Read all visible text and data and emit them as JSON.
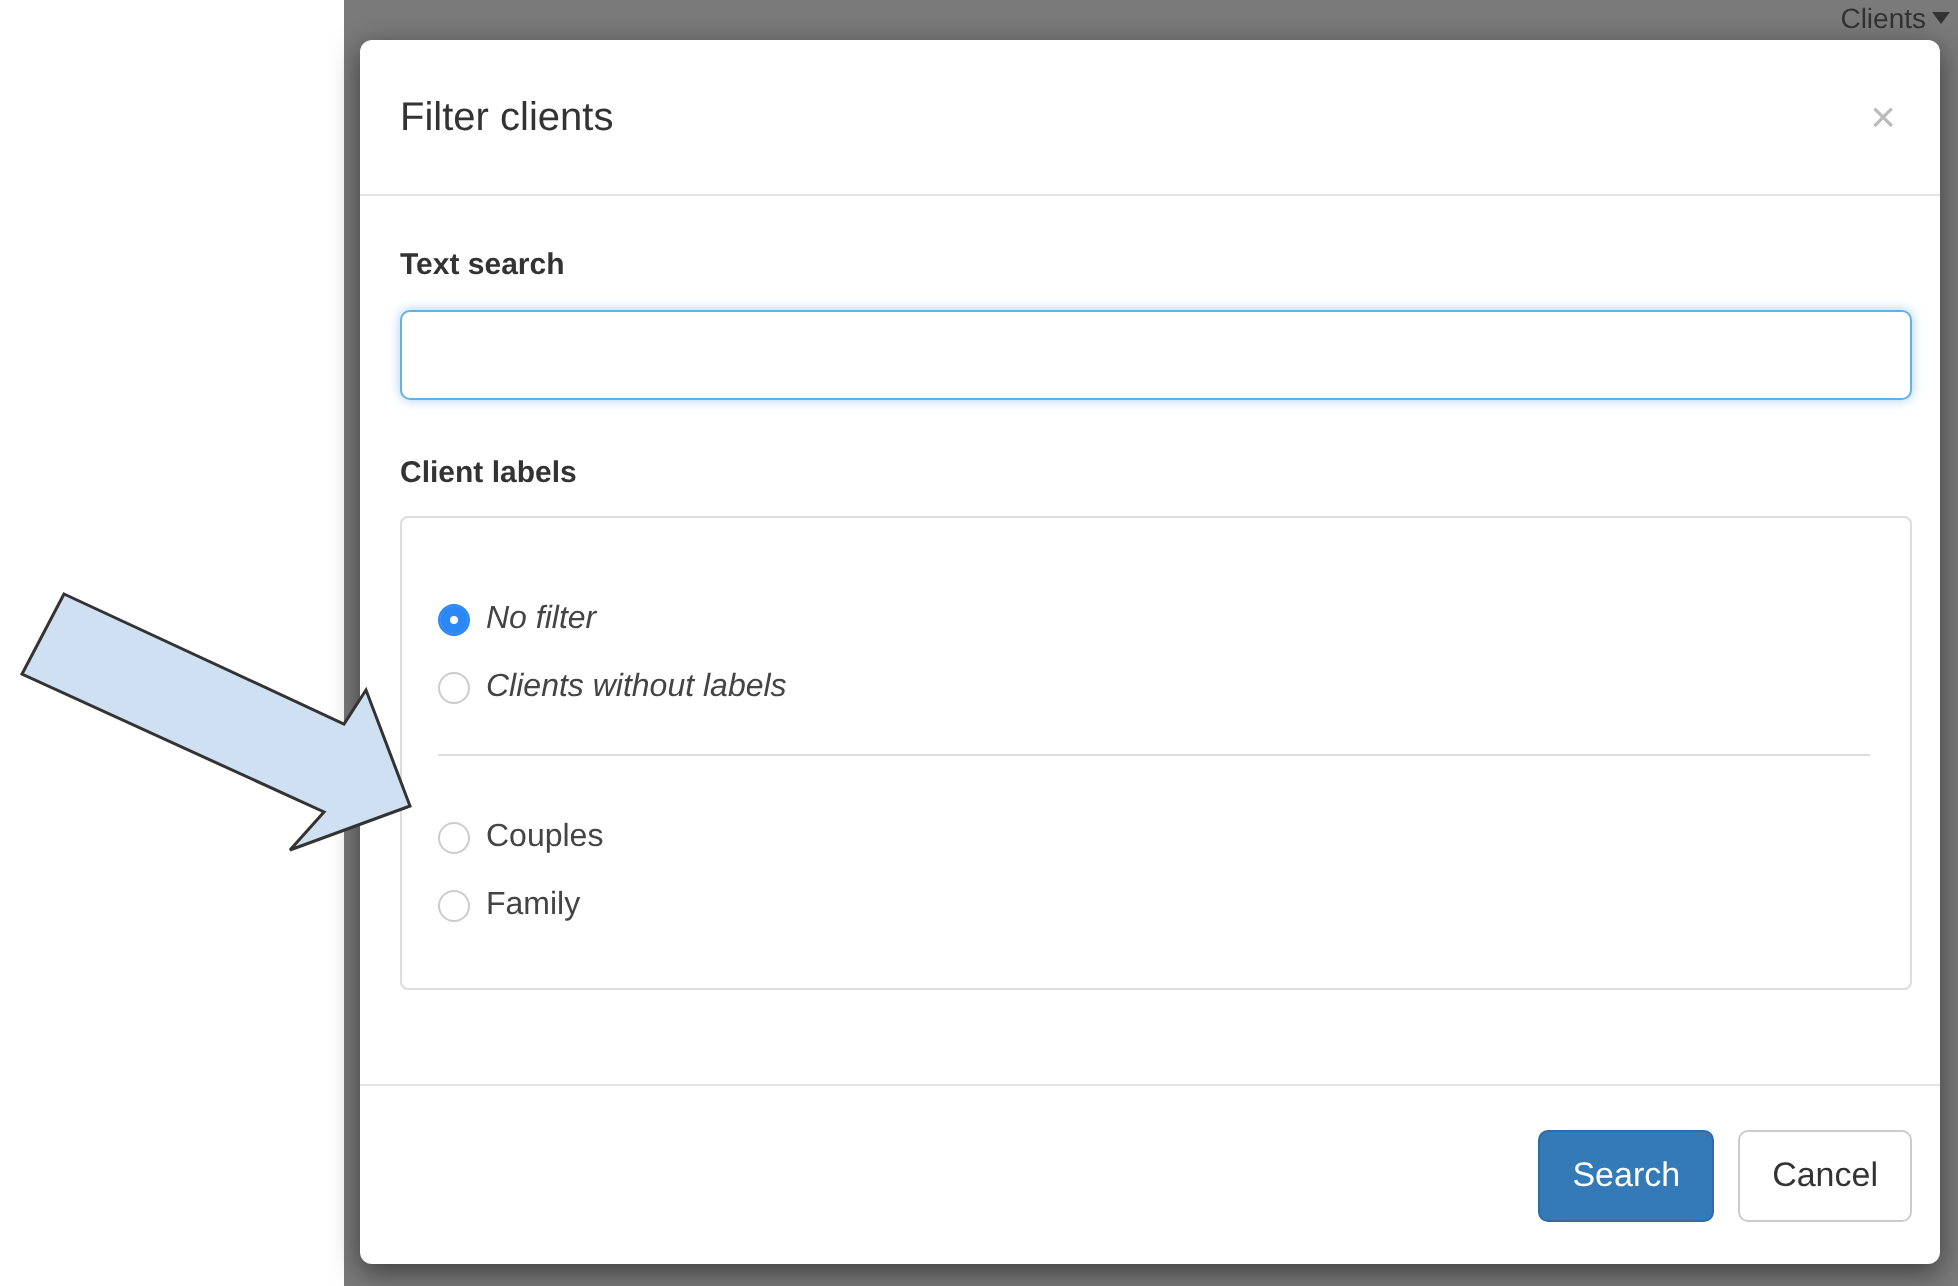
{
  "background_page": {
    "menu_label": "Clients"
  },
  "modal": {
    "title": "Filter clients",
    "close": "×",
    "text_search": {
      "label": "Text search"
    },
    "client_labels": {
      "label": "Client labels",
      "groups": [
        [
          {
            "label": "No filter",
            "selected": true,
            "kind": "special"
          },
          {
            "label": "Clients without labels",
            "selected": false,
            "kind": "special"
          }
        ],
        [
          {
            "label": "Couples",
            "selected": false,
            "kind": "label"
          },
          {
            "label": "Family",
            "selected": false,
            "kind": "label"
          }
        ]
      ]
    },
    "buttons": [
      {
        "label": "Search",
        "kind": "primary"
      },
      {
        "label": "Cancel",
        "kind": "secondary"
      }
    ]
  }
}
